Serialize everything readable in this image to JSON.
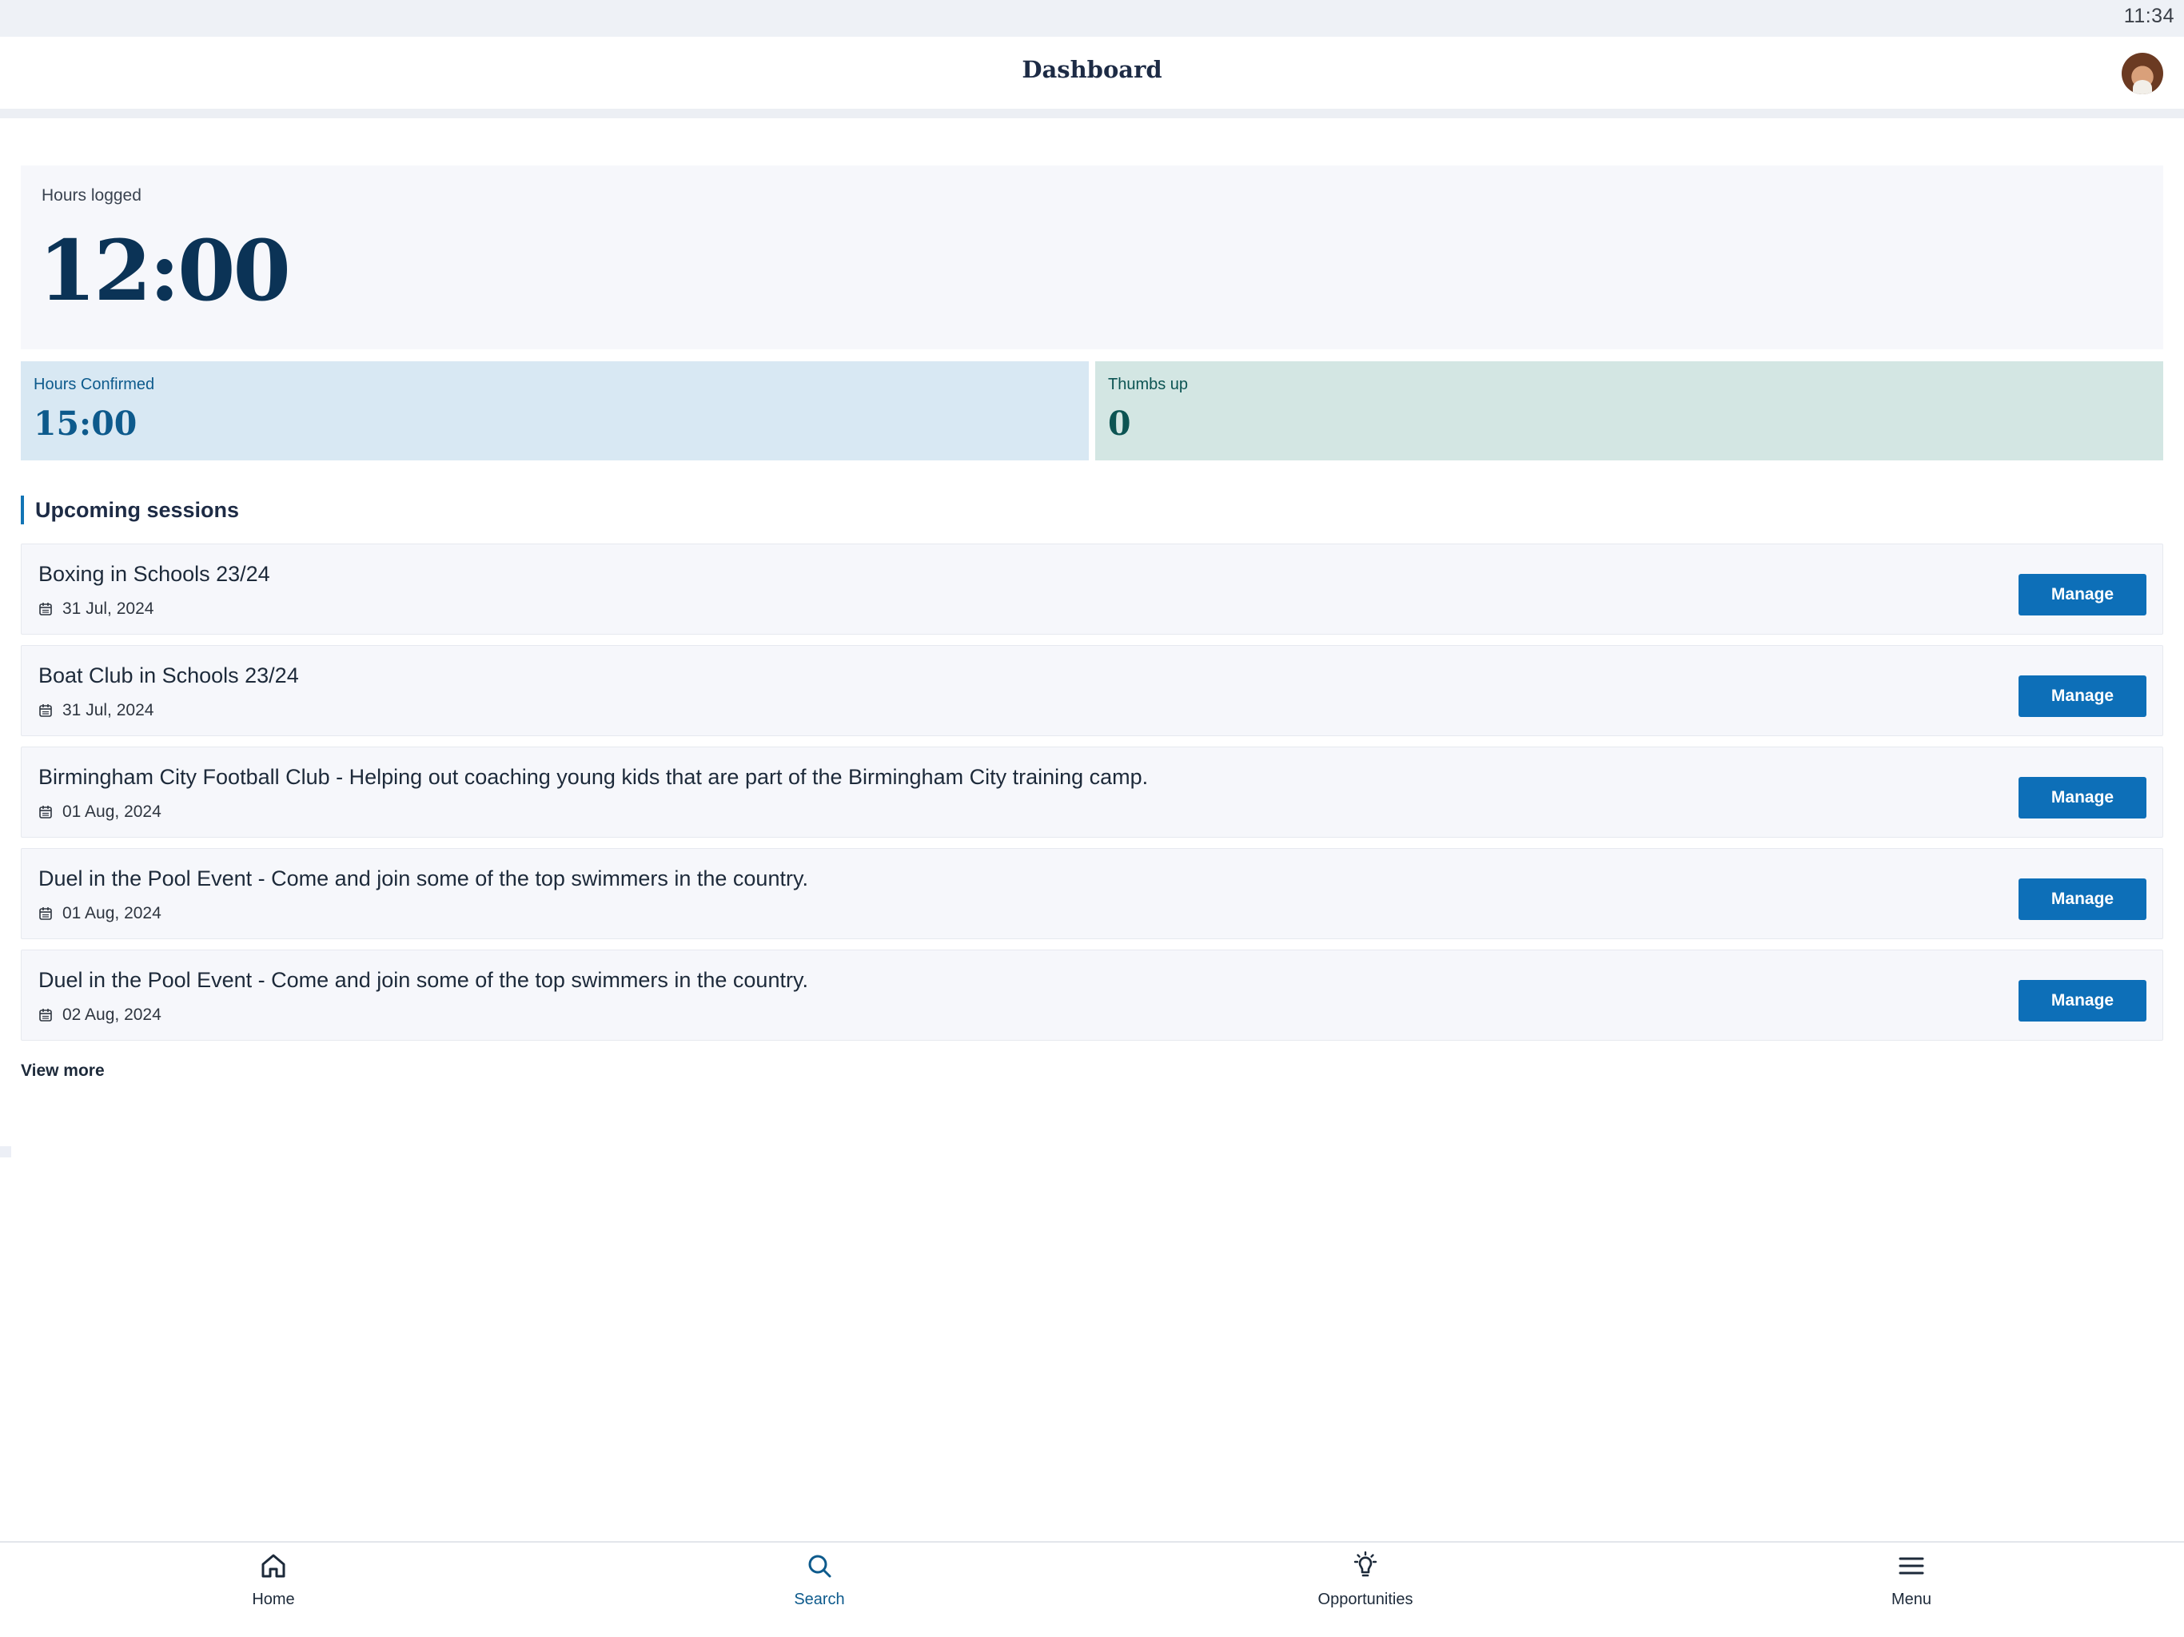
{
  "status_bar": {
    "time": "11:34"
  },
  "header": {
    "title": "Dashboard",
    "avatar_icon": "user-avatar"
  },
  "hours_logged": {
    "label": "Hours logged",
    "value": "12:00"
  },
  "hours_confirmed": {
    "label": "Hours Confirmed",
    "value": "15:00"
  },
  "thumbs_up": {
    "label": "Thumbs up",
    "value": "0"
  },
  "upcoming": {
    "heading": "Upcoming sessions",
    "sessions": [
      {
        "title": "Boxing in Schools 23/24",
        "date": "31 Jul, 2024",
        "button": "Manage"
      },
      {
        "title": "Boat Club in Schools 23/24",
        "date": "31 Jul, 2024",
        "button": "Manage"
      },
      {
        "title": "Birmingham City Football Club - Helping out coaching young kids that are part of the Birmingham City training camp.",
        "date": "01 Aug, 2024",
        "button": "Manage"
      },
      {
        "title": "Duel in the Pool Event - Come and join some of the top swimmers in the country.",
        "date": "01 Aug, 2024",
        "button": "Manage"
      },
      {
        "title": "Duel in the Pool Event - Come and join some of the top swimmers in the country.",
        "date": "02 Aug, 2024",
        "button": "Manage"
      }
    ],
    "view_more": "View more"
  },
  "bottom_nav": {
    "active": "Search",
    "items": [
      {
        "label": "Home",
        "icon": "home-icon"
      },
      {
        "label": "Search",
        "icon": "search-icon"
      },
      {
        "label": "Opportunities",
        "icon": "lightbulb-icon"
      },
      {
        "label": "Menu",
        "icon": "menu-icon"
      }
    ]
  },
  "colors": {
    "accent": "#0d6fb8",
    "primary_dark": "#0b3356",
    "confirmed_bg": "#d8e8f3",
    "thumbs_bg": "#d3e6e3",
    "card_bg": "#f6f7fb"
  }
}
